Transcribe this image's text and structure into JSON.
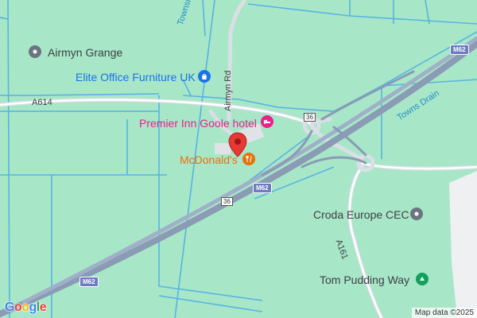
{
  "map": {
    "places": {
      "airmyn_grange": "Airmyn Grange",
      "elite_office": "Elite Office Furniture UK",
      "premier_inn": "Premier Inn Goole hotel",
      "mcdonalds": "McDonald's",
      "croda": "Croda Europe CEC",
      "tom_pudding": "Tom Pudding Way"
    },
    "roads": {
      "a614": "A614",
      "township_drain": "Township Drain",
      "airmyn_rd": "Airmyn Rd",
      "towns_drain": "Towns Drain",
      "a161": "A161",
      "m62_top": "M62",
      "m62_mid": "M62",
      "m62_bottom": "M62",
      "j36_a": "36",
      "j36_b": "36"
    },
    "attribution": "Map data ©2025",
    "logo": "Google"
  },
  "colors": {
    "land": "#a8e6c8",
    "motorway": "#8a9bb4",
    "road": "#c9d1d9",
    "water": "#56b4e0",
    "pin": "#e53935"
  }
}
